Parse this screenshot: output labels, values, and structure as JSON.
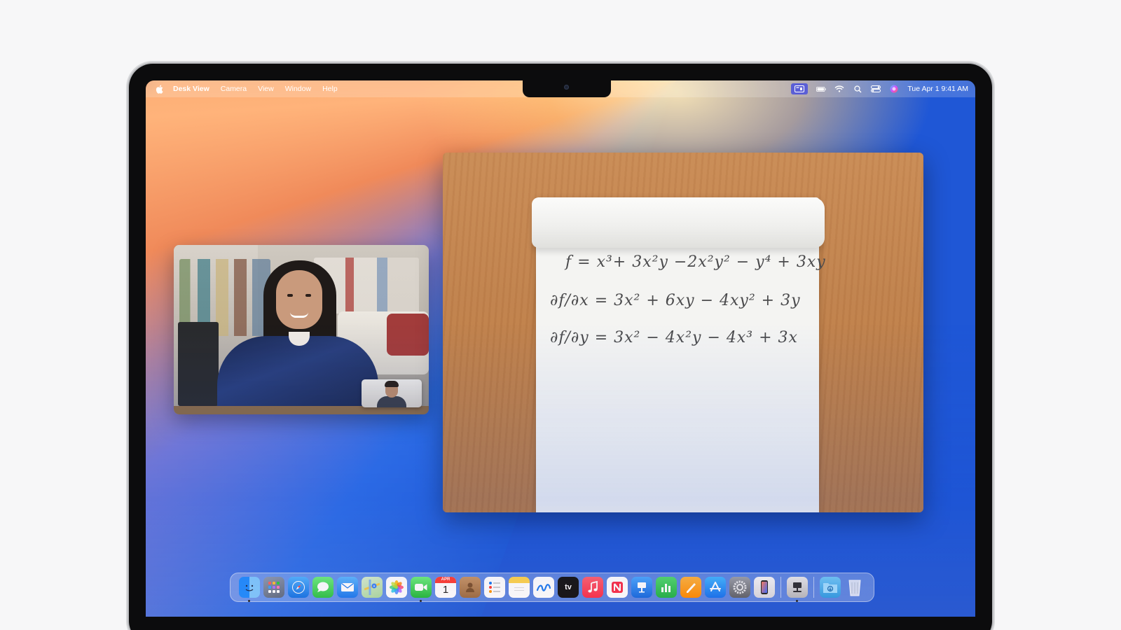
{
  "menubar": {
    "app_name": "Desk View",
    "menus": [
      "Camera",
      "View",
      "Window",
      "Help"
    ],
    "clock": "Tue Apr 1  9:41 AM"
  },
  "deskview": {
    "equations": [
      "f = x³+ 3x²y −2x²y² − y⁴ + 3xy",
      "∂f/∂x = 3x² + 6xy − 4xy² + 3y",
      "∂f/∂y = 3x² − 4x²y − 4x³ + 3x"
    ]
  },
  "dock": {
    "calendar_month": "APR",
    "calendar_day": "1",
    "tv_label": "tv",
    "items": [
      "finder-icon",
      "launchpad-icon",
      "safari-icon",
      "messages-icon",
      "mail-icon",
      "maps-icon",
      "photos-icon",
      "facetime-icon",
      "calendar-icon",
      "contacts-icon",
      "reminders-icon",
      "notes-icon",
      "freeform-icon",
      "apple-tv-icon",
      "music-icon",
      "news-icon",
      "keynote-icon",
      "numbers-icon",
      "pages-icon",
      "app-store-icon",
      "system-settings-icon",
      "iphone-mirroring-icon",
      "desk-view-icon",
      "downloads-folder-icon",
      "trash-icon"
    ]
  },
  "colors": {
    "menubar_active": "#5b5fd6",
    "dock_bg": "rgba(255,255,255,0.28)"
  }
}
